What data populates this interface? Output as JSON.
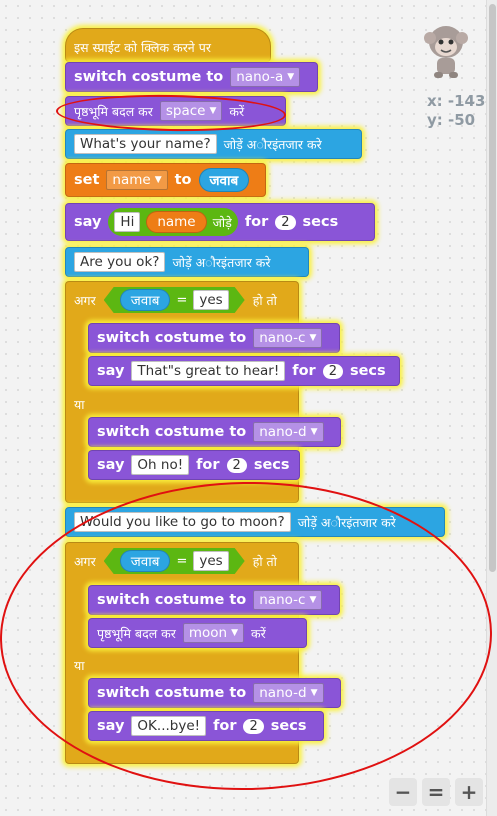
{
  "sprite": {
    "x_label": "x: -143",
    "y_label": "y: -50"
  },
  "hat": {
    "label": "इस स्प्राईट को क्लिक करने पर"
  },
  "b1": {
    "label": "switch costume to",
    "value": "nano-a"
  },
  "b2": {
    "label": "पृष्ठभूमि बदल कर",
    "value": "space",
    "suffix": "करें"
  },
  "b3": {
    "question": "What's your name?",
    "suffix": "जोड़ें अौरइंतजार करे"
  },
  "b4": {
    "label": "set",
    "var": "name",
    "to": "to",
    "value": "जवाब"
  },
  "b5": {
    "label": "say",
    "text": "Hi",
    "join_var": "name",
    "join_label": "जोड़े",
    "for": "for",
    "secs_value": "2",
    "secs": "secs"
  },
  "b6": {
    "question": "Are you ok?",
    "suffix": "जोड़ें अौरइंतजार करे"
  },
  "if1": {
    "if_label": "अगर",
    "answer": "जवाब",
    "eq": "=",
    "value": "yes",
    "then": "हो तो",
    "c1": {
      "label": "switch costume to",
      "value": "nano-c"
    },
    "c2": {
      "label": "say",
      "text": "That\"s great to hear!",
      "for": "for",
      "secs_value": "2",
      "secs": "secs"
    },
    "else_label": "या",
    "c3": {
      "label": "switch costume to",
      "value": "nano-d"
    },
    "c4": {
      "label": "say",
      "text": "Oh no!",
      "for": "for",
      "secs_value": "2",
      "secs": "secs"
    }
  },
  "b7": {
    "question": "Would you like to go to moon?",
    "suffix": "जोड़ें अौरइंतजार करे"
  },
  "if2": {
    "if_label": "अगर",
    "answer": "जवाब",
    "eq": "=",
    "value": "yes",
    "then": "हो तो",
    "c1": {
      "label": "switch costume to",
      "value": "nano-c"
    },
    "c2": {
      "label": "पृष्ठभूमि बदल कर",
      "value": "moon",
      "suffix": "करें"
    },
    "else_label": "या",
    "c3": {
      "label": "switch costume to",
      "value": "nano-d"
    },
    "c4": {
      "label": "say",
      "text": "OK...bye!",
      "for": "for",
      "secs_value": "2",
      "secs": "secs"
    }
  },
  "zoom": {
    "out": "−",
    "reset": "=",
    "in": "+"
  },
  "colors": {
    "looks": "#8a55d7",
    "sensing": "#2ca5e2",
    "control": "#e1a91a",
    "data": "#ee7d16",
    "operator": "#5cb712",
    "highlight": "#e01111"
  }
}
